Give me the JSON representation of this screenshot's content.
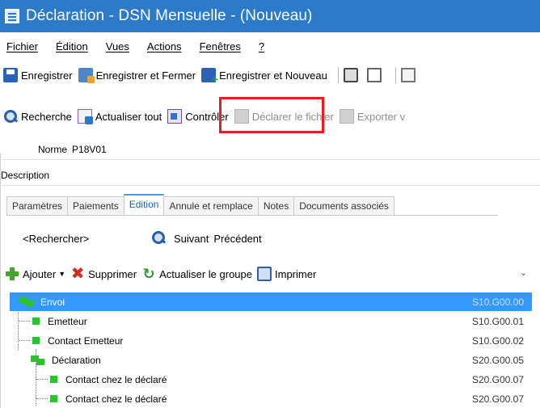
{
  "window": {
    "title": "Déclaration - DSN Mensuelle - (Nouveau)"
  },
  "menu": [
    {
      "label": "Fichier"
    },
    {
      "label": "Édition"
    },
    {
      "label": "Vues"
    },
    {
      "label": "Actions"
    },
    {
      "label": "Fenêtres"
    },
    {
      "label": "?"
    }
  ],
  "toolbar1": {
    "save": "Enregistrer",
    "save_close": "Enregistrer et Fermer",
    "save_new": "Enregistrer et Nouveau"
  },
  "toolbar2": {
    "search": "Recherche",
    "refresh_all": "Actualiser tout",
    "control": "Contrôler",
    "declare": "Déclarer le fichier",
    "export": "Exporter v"
  },
  "fields": {
    "norme_label": "Norme",
    "norme_value": "P18V01",
    "description_label": "Description",
    "description_value": ""
  },
  "tabs": [
    {
      "label": "Paramètres"
    },
    {
      "label": "Paiements"
    },
    {
      "label": "Edition",
      "active": true
    },
    {
      "label": "Annule et remplace"
    },
    {
      "label": "Notes"
    },
    {
      "label": "Documents associés"
    }
  ],
  "search": {
    "placeholder": "<Rechercher>",
    "next": "Suivant",
    "prev": "Précédent"
  },
  "actions": {
    "add": "Ajouter",
    "delete": "Supprimer",
    "refresh_group": "Actualiser le groupe",
    "print": "Imprimer"
  },
  "tree": [
    {
      "label": "Envoi",
      "code": "S10.G00.00",
      "level": 0,
      "type": "group",
      "selected": true
    },
    {
      "label": "Emetteur",
      "code": "S10.G00.01",
      "level": 1,
      "type": "leaf"
    },
    {
      "label": "Contact Emetteur",
      "code": "S10.G00.02",
      "level": 1,
      "type": "leaf"
    },
    {
      "label": "Déclaration",
      "code": "S20.G00.05",
      "level": 1,
      "type": "group"
    },
    {
      "label": "Contact chez le déclaré",
      "code": "S20.G00.07",
      "level": 2,
      "type": "leaf"
    },
    {
      "label": "Contact chez le déclaré",
      "code": "S20.G00.07",
      "level": 2,
      "type": "leaf"
    }
  ],
  "colors": {
    "titlebar": "#2b7bc9",
    "selection": "#3399ff",
    "highlight": "#e0211f",
    "node": "#2ec232"
  }
}
